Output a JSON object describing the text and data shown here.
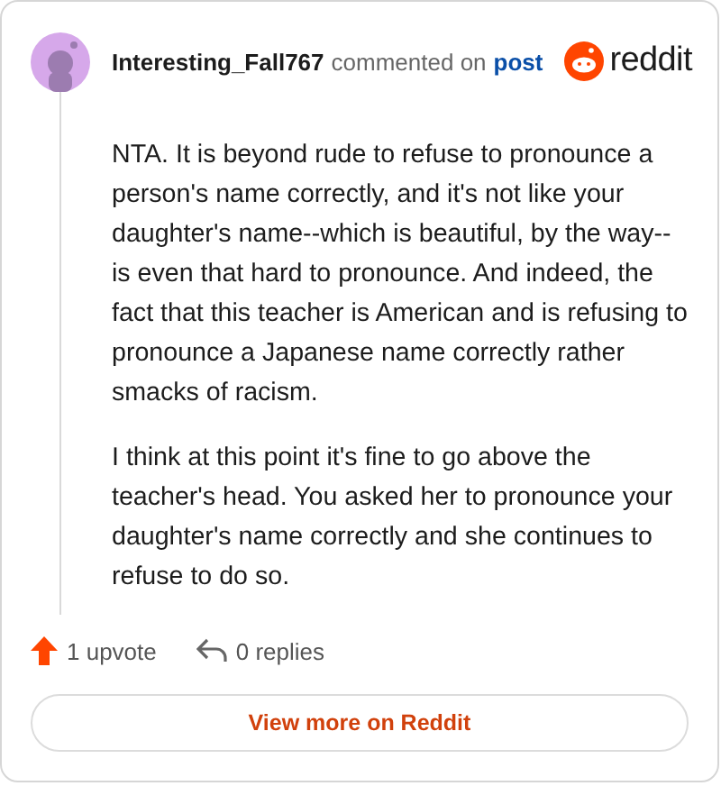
{
  "header": {
    "author": "Interesting_Fall767",
    "action": "commented on",
    "link": "post",
    "brand": "reddit"
  },
  "comment": {
    "paragraphs": [
      "NTA. It is beyond rude to refuse to pronounce a person's name correctly, and it's not like your daughter's name--which is beautiful, by the way--is even that hard to pronounce. And indeed, the fact that this teacher is American and is refusing to pronounce a Japanese name correctly rather smacks of racism.",
      "I think at this point it's fine to go above the teacher's head. You asked her to pronounce your daughter's name correctly and she continues to refuse to do so."
    ]
  },
  "footer": {
    "upvotes": "1 upvote",
    "replies": "0 replies"
  },
  "button": "View more on Reddit"
}
